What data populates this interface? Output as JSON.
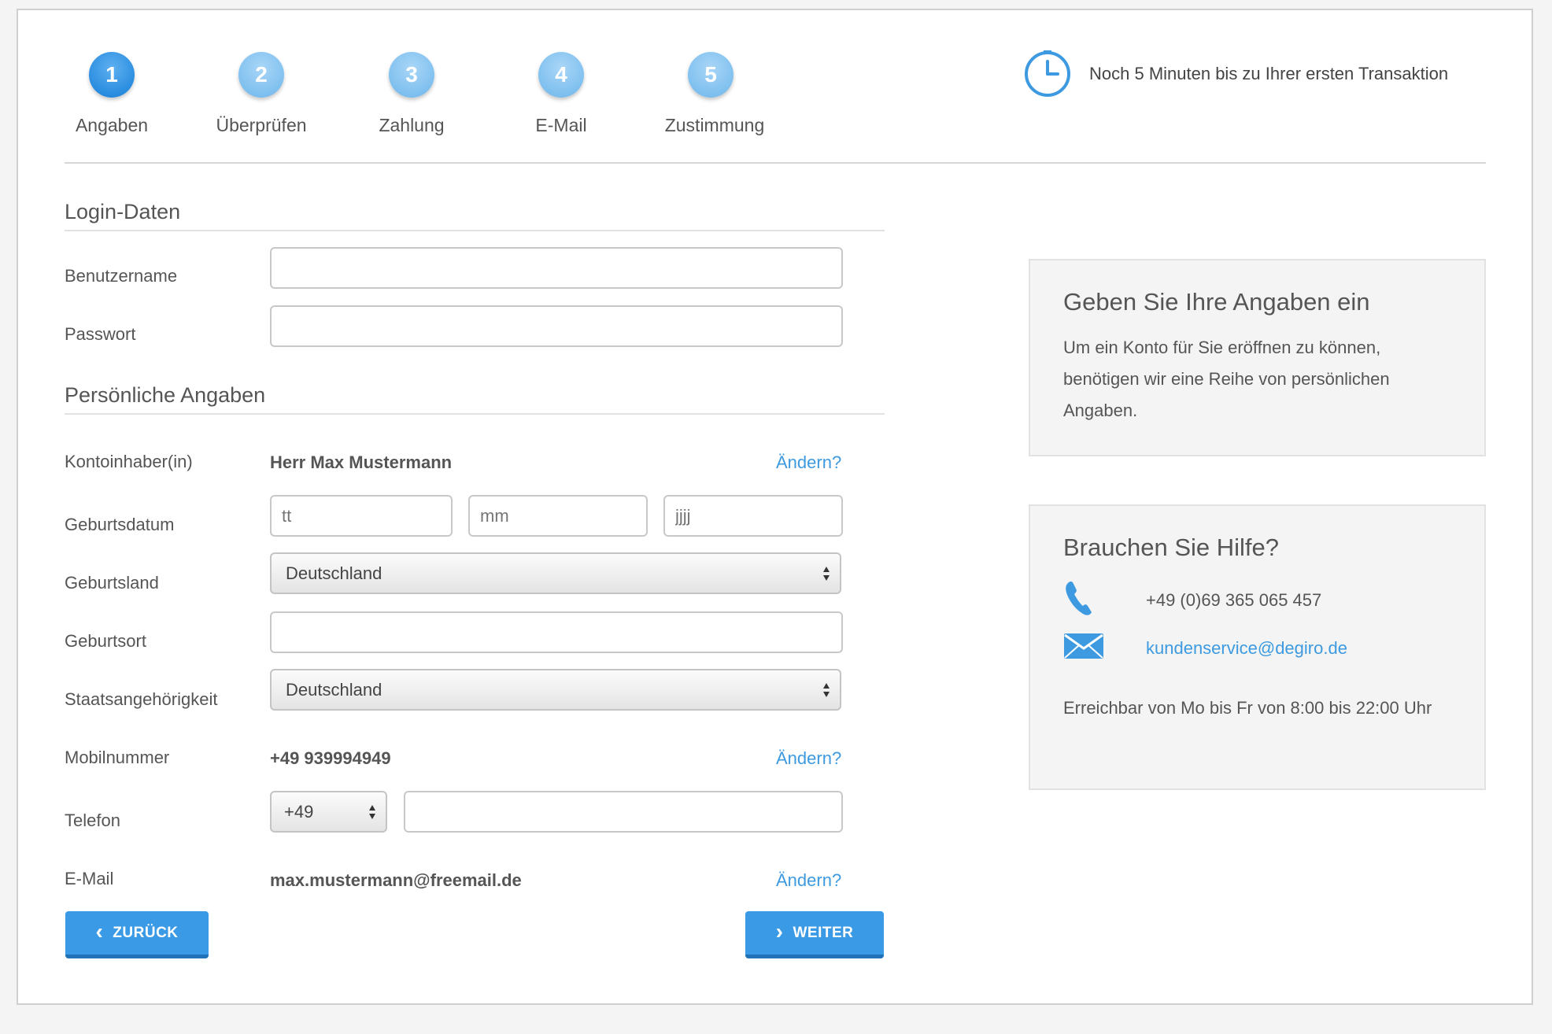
{
  "stepper": {
    "steps": [
      {
        "number": "1",
        "label": "Angaben"
      },
      {
        "number": "2",
        "label": "Überprüfen"
      },
      {
        "number": "3",
        "label": "Zahlung"
      },
      {
        "number": "4",
        "label": "E-Mail"
      },
      {
        "number": "5",
        "label": "Zustimmung"
      }
    ],
    "active_step": 1,
    "timer_text": "Noch 5 Minuten bis zu Ihrer ersten Transaktion"
  },
  "login": {
    "title": "Login-Daten",
    "username_label": "Benutzername",
    "username_value": "",
    "password_label": "Passwort",
    "password_value": ""
  },
  "personal": {
    "title": "Persönliche Angaben",
    "holder_label": "Kontoinhaber(in)",
    "holder_value": "Herr Max Mustermann",
    "change_label": "Ändern?",
    "birthdate_label": "Geburtsdatum",
    "birthdate_day_placeholder": "tt",
    "birthdate_month_placeholder": "mm",
    "birthdate_year_placeholder": "jjjj",
    "birth_country_label": "Geburtsland",
    "birth_country_value": "Deutschland",
    "birth_place_label": "Geburtsort",
    "birth_place_value": "",
    "nationality_label": "Staatsangehörigkeit",
    "nationality_value": "Deutschland",
    "mobile_label": "Mobilnummer",
    "mobile_value": "+49 939994949",
    "phone_label": "Telefon",
    "phone_prefix_value": "+49",
    "phone_value": "",
    "email_label": "E-Mail",
    "email_value": "max.mustermann@freemail.de"
  },
  "buttons": {
    "back_label": "ZURÜCK",
    "next_label": "WEITER"
  },
  "info_panel": {
    "title": "Geben Sie Ihre Angaben ein",
    "text": "Um ein Konto für Sie eröffnen zu können, benötigen wir eine Reihe von persönlichen Angaben."
  },
  "help_panel": {
    "title": "Brauchen Sie Hilfe?",
    "phone": "+49 (0)69 365 065 457",
    "email": "kundenservice@degiro.de",
    "hours": "Erreichbar von Mo bis Fr von 8:00 bis 22:00 Uhr"
  },
  "colors": {
    "accent": "#3a9ae6",
    "link": "#3d9ae0",
    "step_active": "#2a8de0",
    "step_inactive": "#7fc0ef"
  },
  "icons": {
    "timer": "clock-icon",
    "phone": "phone-icon",
    "email": "envelope-icon",
    "back": "chevron-left-icon",
    "next": "chevron-right-icon"
  }
}
